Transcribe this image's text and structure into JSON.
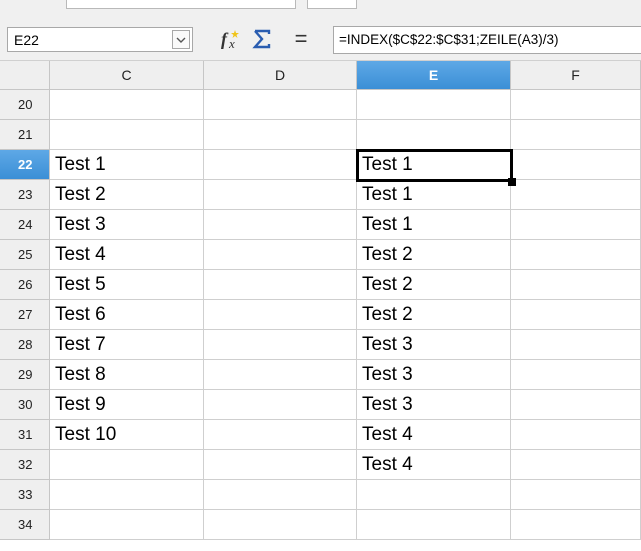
{
  "namebox": {
    "value": "E22"
  },
  "toolbar": {
    "function_wizard_icon": "function-wizard-icon",
    "sum_icon": "sum-icon",
    "equals_label": "="
  },
  "formula": {
    "value": "=INDEX($C$22:$C$31;ZEILE(A3)/3)"
  },
  "columns": [
    "C",
    "D",
    "E",
    "F"
  ],
  "active_column": "E",
  "active_row": "22",
  "rows": [
    {
      "num": "20",
      "C": "",
      "D": "",
      "E": "",
      "F": ""
    },
    {
      "num": "21",
      "C": "",
      "D": "",
      "E": "",
      "F": ""
    },
    {
      "num": "22",
      "C": "Test 1",
      "D": "",
      "E": "Test 1",
      "F": ""
    },
    {
      "num": "23",
      "C": "Test 2",
      "D": "",
      "E": "Test 1",
      "F": ""
    },
    {
      "num": "24",
      "C": "Test 3",
      "D": "",
      "E": "Test 1",
      "F": ""
    },
    {
      "num": "25",
      "C": "Test 4",
      "D": "",
      "E": "Test 2",
      "F": ""
    },
    {
      "num": "26",
      "C": "Test 5",
      "D": "",
      "E": "Test 2",
      "F": ""
    },
    {
      "num": "27",
      "C": "Test 6",
      "D": "",
      "E": "Test 2",
      "F": ""
    },
    {
      "num": "28",
      "C": "Test 7",
      "D": "",
      "E": "Test 3",
      "F": ""
    },
    {
      "num": "29",
      "C": "Test 8",
      "D": "",
      "E": "Test 3",
      "F": ""
    },
    {
      "num": "30",
      "C": "Test 9",
      "D": "",
      "E": "Test 3",
      "F": ""
    },
    {
      "num": "31",
      "C": "Test 10",
      "D": "",
      "E": "Test 4",
      "F": ""
    },
    {
      "num": "32",
      "C": "",
      "D": "",
      "E": "Test 4",
      "F": ""
    },
    {
      "num": "33",
      "C": "",
      "D": "",
      "E": "",
      "F": ""
    },
    {
      "num": "34",
      "C": "",
      "D": "",
      "E": "",
      "F": ""
    }
  ],
  "colors": {
    "active_header": "#3b8fd6",
    "grid_line": "#cfcfcf",
    "header_bg": "#efefef"
  }
}
